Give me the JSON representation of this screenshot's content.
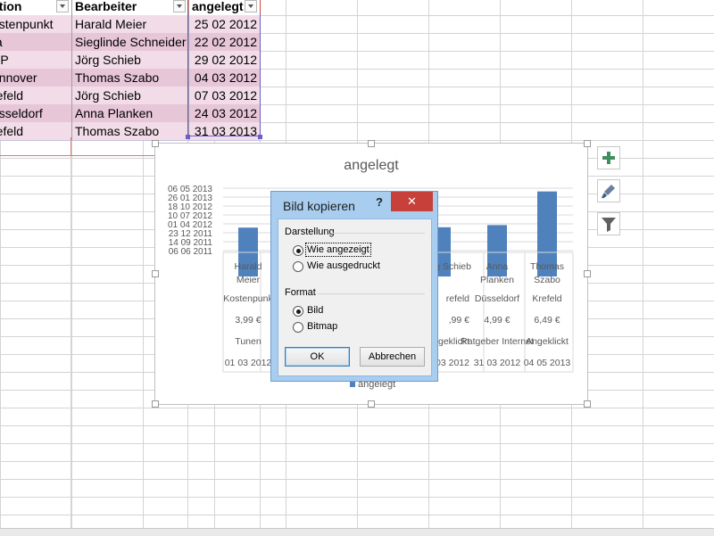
{
  "table": {
    "headers": [
      "ktion",
      "Bearbeiter",
      "angelegt"
    ],
    "rows": [
      [
        "ostenpunkt",
        "Harald Meier",
        "25 02 2012"
      ],
      [
        "fa",
        "Sieglinde Schneider",
        "22 02 2012"
      ],
      [
        "XP",
        "Jörg Schieb",
        "29 02 2012"
      ],
      [
        "annover",
        "Thomas Szabo",
        "04 03 2012"
      ],
      [
        "refeld",
        "Jörg Schieb",
        "07 03 2012"
      ],
      [
        "üsseldorf",
        "Anna Planken",
        "24 03 2012"
      ],
      [
        "refeld",
        "Thomas Szabo",
        "31 03 2013"
      ]
    ]
  },
  "chart": {
    "title": "angelegt",
    "legend": "angelegt",
    "row_labels": [
      "Kostenpunkt",
      "3,99 €",
      "Tunen",
      "01 03 2012"
    ],
    "visible_cells": [
      [
        "Kostenpunk",
        "3,99 €",
        "Tunen",
        "01 03 2012"
      ],
      [
        "refeld",
        ",99 €",
        "geklickt",
        "03 2012"
      ],
      [
        "Düsseldorf",
        "4,99 €",
        "Ratgeber Internet",
        "31 03 2012"
      ],
      [
        "Krefeld",
        "6,49 €",
        "Angeklickt",
        "04 05 2013"
      ]
    ],
    "category_names": [
      "Harald Meier",
      "Jörg Schieb",
      "Anna Planken",
      "Thomas Szabo"
    ]
  },
  "chart_data": {
    "type": "bar",
    "title": "angelegt",
    "ylabel": "",
    "xlabel": "",
    "y_ticks": [
      "06 05 2013",
      "26 01 2013",
      "18 10 2012",
      "10 07 2012",
      "01 04 2012",
      "23 12 2011",
      "14 09 2011",
      "06 06 2011"
    ],
    "categories": [
      "Harald Meier",
      "Jörg Schieb",
      "Anna Planken",
      "Thomas Szabo"
    ],
    "values": [
      "25 02 2012",
      "29 02 2012",
      "24 03 2012",
      "31 03 2013"
    ],
    "series_color": "#4f81bd",
    "legend_position": "bottom",
    "grid": true
  },
  "dialog": {
    "title": "Bild kopieren",
    "help": "?",
    "close": "✕",
    "group1_label": "Darstellung",
    "option_screen": "Wie angezeigt",
    "option_print": "Wie ausgedruckt",
    "group2_label": "Format",
    "option_picture": "Bild",
    "option_bitmap": "Bitmap",
    "ok": "OK",
    "cancel": "Abbrechen"
  },
  "side_buttons": [
    "plus-icon",
    "brush-icon",
    "filter-icon"
  ],
  "colors": {
    "accent": "#4f81bd",
    "table_band_odd": "#f1dce8",
    "table_band_even": "#e7c6d8",
    "close_red": "#c7403a",
    "dialog_frame": "#a8cdef"
  }
}
